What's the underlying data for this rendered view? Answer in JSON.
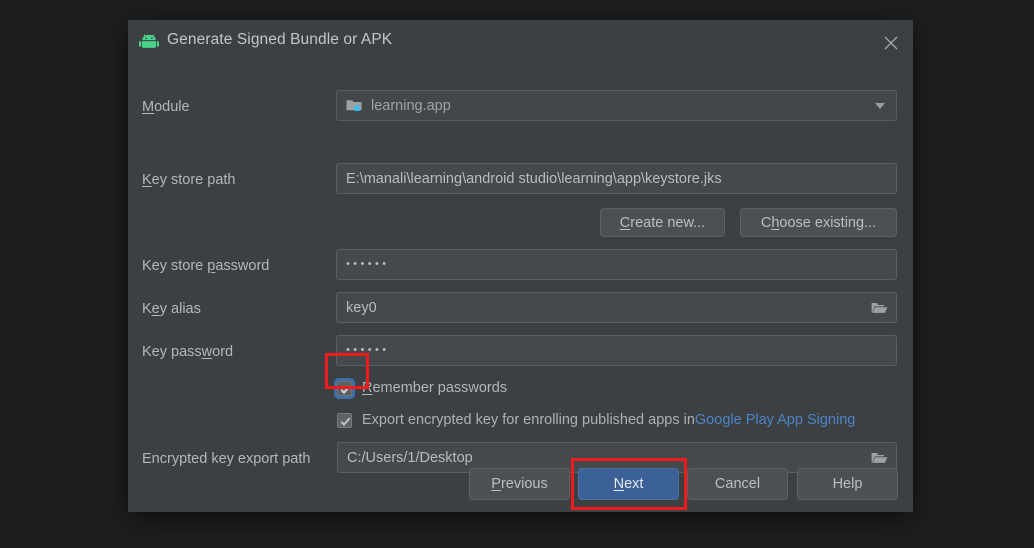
{
  "window": {
    "title": "Generate Signed Bundle or APK",
    "app_icon": "android-robot-icon",
    "close_icon": "close-icon"
  },
  "form": {
    "module": {
      "label": "Module",
      "label_mnemonic": "M",
      "value": "learning.app",
      "icon": "module-folder-icon",
      "dropdown_icon": "chevron-down-icon"
    },
    "key_store_path": {
      "label": "Key store path",
      "label_mnemonic": "K",
      "value": "E:\\manali\\learning\\android studio\\learning\\app\\keystore.jks"
    },
    "create_new_button": {
      "label": "Create new...",
      "mnemonic": "C"
    },
    "choose_existing_button": {
      "label": "Choose existing...",
      "mnemonic": "h"
    },
    "key_store_password": {
      "label": "Key store password",
      "label_mnemonic": "p",
      "value": "••••••"
    },
    "key_alias": {
      "label": "Key alias",
      "label_mnemonic": "e",
      "value": "key0",
      "browse_icon": "folder-icon"
    },
    "key_password": {
      "label": "Key password",
      "label_mnemonic": "w",
      "value": "••••••"
    },
    "remember_passwords": {
      "label": "Remember passwords",
      "mnemonic": "R",
      "checked": "true",
      "focused": "true"
    },
    "export_encrypted_key": {
      "label_prefix": "Export encrypted key for enrolling published apps in",
      "link_label": "Google Play App Signing",
      "checked": "true"
    },
    "encrypted_key_export_path": {
      "label": "Encrypted key export path",
      "value": "C:/Users/1/Desktop",
      "browse_icon": "folder-icon"
    }
  },
  "footer": {
    "previous_button": {
      "label": "Previous",
      "mnemonic": "P"
    },
    "next_button": {
      "label": "Next",
      "mnemonic": "N"
    },
    "cancel_button": {
      "label": "Cancel"
    },
    "help_button": {
      "label": "Help"
    }
  },
  "annotations": {
    "checkbox_highlight": "red-box-remember-passwords",
    "next_highlight": "red-box-next-button"
  },
  "colors": {
    "dialog_bg": "#3c4043",
    "desktop_bg": "#1d1e20",
    "accent_blue": "#3c6098",
    "link_blue": "#4d84c8",
    "annotation_red": "#f01a1a",
    "android_green": "#3ddc84"
  }
}
